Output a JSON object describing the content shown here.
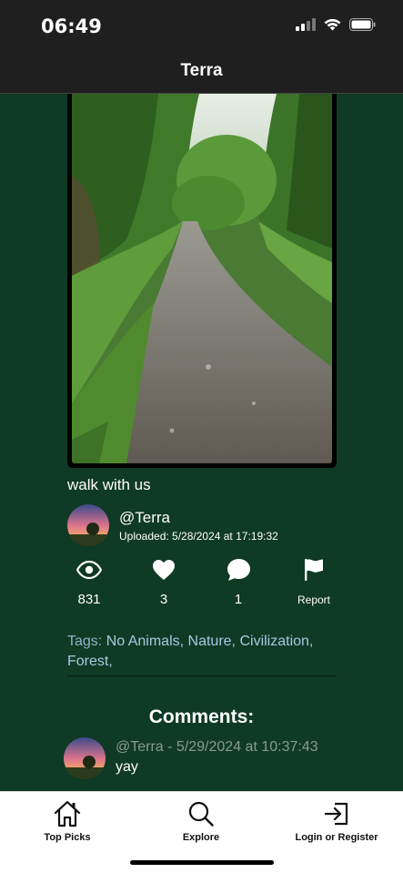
{
  "status_bar": {
    "time": "06:49",
    "icons": [
      "signal-icon",
      "wifi-icon",
      "battery-icon"
    ]
  },
  "nav": {
    "title": "Terra"
  },
  "post": {
    "photo_alt": "forest-path-photo",
    "caption": "walk with us",
    "author": {
      "handle": "@Terra",
      "uploaded": "Uploaded: 5/28/2024 at 17:19:32"
    },
    "stats": {
      "views": "831",
      "likes": "3",
      "comments": "1",
      "report_label": "Report"
    },
    "tags_label": "Tags:",
    "tags": [
      "No Animals,",
      "Nature,",
      "Civilization,",
      "Forest,"
    ]
  },
  "comments": {
    "heading": "Comments:",
    "items": [
      {
        "meta": "@Terra - 5/29/2024 at 10:37:43",
        "text": "yay"
      }
    ]
  },
  "tab_bar": {
    "items": [
      {
        "label": "Top Picks",
        "icon": "home-icon"
      },
      {
        "label": "Explore",
        "icon": "search-icon"
      },
      {
        "label": "Login or Register",
        "icon": "login-icon"
      }
    ]
  },
  "colors": {
    "background": "#0f3a25",
    "bar": "#1f1f1f",
    "tag": "#a9c9e0"
  }
}
